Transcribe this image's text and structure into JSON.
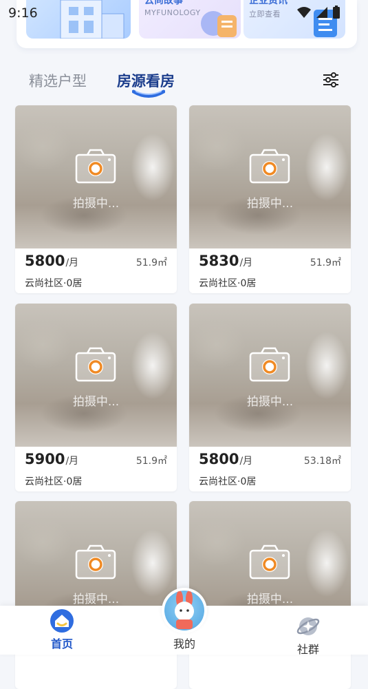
{
  "status": {
    "time": "9:16"
  },
  "banners": [
    {
      "title": "",
      "subtitle": ""
    },
    {
      "title": "云尚故事",
      "subtitle": "MYFUNOLOGY"
    },
    {
      "title": "企业资讯",
      "subtitle": "立即查看"
    }
  ],
  "tabs": {
    "featured": "精选户型",
    "listing": "房源看房"
  },
  "listings": [
    {
      "price": "5800",
      "unit": "/月",
      "area": "51.9㎡",
      "community": "云尚社区·0居",
      "photo_status": "拍摄中..."
    },
    {
      "price": "5830",
      "unit": "/月",
      "area": "51.9㎡",
      "community": "云尚社区·0居",
      "photo_status": "拍摄中..."
    },
    {
      "price": "5900",
      "unit": "/月",
      "area": "51.9㎡",
      "community": "云尚社区·0居",
      "photo_status": "拍摄中..."
    },
    {
      "price": "5800",
      "unit": "/月",
      "area": "53.18㎡",
      "community": "云尚社区·0居",
      "photo_status": "拍摄中..."
    },
    {
      "photo_status": "拍摄中..."
    },
    {
      "photo_status": "拍摄中..."
    }
  ],
  "nav": {
    "home": "首页",
    "me": "我的",
    "group": "社群"
  },
  "icons": {
    "camera": "camera-icon",
    "filter": "filter-sliders-icon",
    "home": "home-icon",
    "group": "planet-icon",
    "avatar": "rabbit-avatar"
  },
  "colors": {
    "accent": "#1e55c8",
    "camera_ring": "#f08a24",
    "tab_active": "#1b3d8c"
  }
}
